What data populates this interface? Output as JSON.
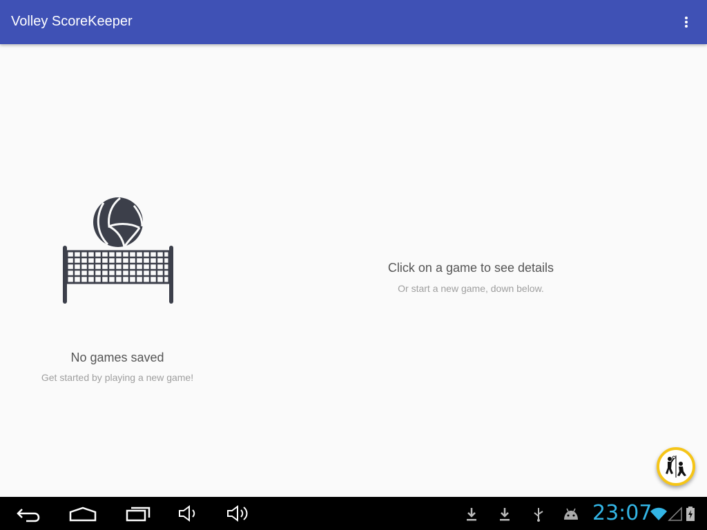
{
  "app": {
    "title": "Volley ScoreKeeper",
    "colors": {
      "primary": "#3f51b5",
      "accent": "#f5c518",
      "clock": "#33b5e5"
    }
  },
  "empty_state": {
    "title": "No games saved",
    "subtitle": "Get started by playing a new game!"
  },
  "details": {
    "title": "Click on a game to see details",
    "subtitle": "Or start a new game, down below."
  },
  "fab": {
    "icon": "volleyball-players-icon"
  },
  "system_bar": {
    "time": "23:07",
    "nav_icons": [
      "back-icon",
      "home-icon",
      "recent-apps-icon",
      "volume-down-icon",
      "volume-up-icon"
    ],
    "status_icons": [
      "download-icon",
      "download-icon",
      "usb-icon",
      "android-debug-icon",
      "wifi-icon",
      "signal-icon",
      "battery-charging-icon"
    ]
  }
}
